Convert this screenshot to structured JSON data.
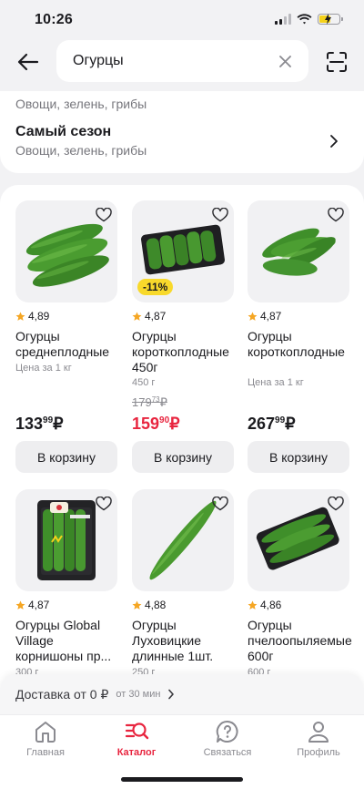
{
  "status": {
    "time": "10:26"
  },
  "search": {
    "value": "Огурцы"
  },
  "categories": {
    "previous_sub": "Овощи, зелень, грибы",
    "item": {
      "title": "Самый сезон",
      "subtitle": "Овощи, зелень, грибы"
    }
  },
  "products": [
    {
      "rating": "4,89",
      "name": "Огурцы среднеплодные",
      "meta": "Цена за 1 кг",
      "price_main": "133",
      "price_kop": "99",
      "currency": "₽",
      "cta": "В корзину"
    },
    {
      "rating": "4,87",
      "badge": "-11%",
      "name": "Огурцы короткоплодные 450г",
      "meta": "450 г",
      "old_main": "179",
      "old_kop": "73",
      "price_main": "159",
      "price_kop": "90",
      "currency": "₽",
      "cta": "В корзину"
    },
    {
      "rating": "4,87",
      "name": "Огурцы короткоплодные",
      "meta": "Цена за 1 кг",
      "price_main": "267",
      "price_kop": "99",
      "currency": "₽",
      "cta": "В корзину"
    },
    {
      "rating": "4,87",
      "name": "Огурцы Global Village корнишоны пр...",
      "meta": "300 г",
      "image_brand": "Global Village"
    },
    {
      "rating": "4,88",
      "name": "Огурцы Луховицкие длинные 1шт.",
      "meta": "250 г"
    },
    {
      "rating": "4,86",
      "name": "Огурцы пчелоопыляемые 600г",
      "meta": "600 г"
    }
  ],
  "delivery": {
    "main": "Доставка от 0 ₽",
    "sub": "от 30 мин"
  },
  "tabs": [
    {
      "label": "Главная",
      "icon": "home-icon"
    },
    {
      "label": "Каталог",
      "icon": "catalog-search-icon",
      "active": true
    },
    {
      "label": "Связаться",
      "icon": "help-icon"
    },
    {
      "label": "Профиль",
      "icon": "profile-icon"
    }
  ],
  "colors": {
    "accent": "#e8253f",
    "badge": "#f8d92b",
    "star": "#f5a623",
    "cucumber": "#3f8f2a"
  }
}
